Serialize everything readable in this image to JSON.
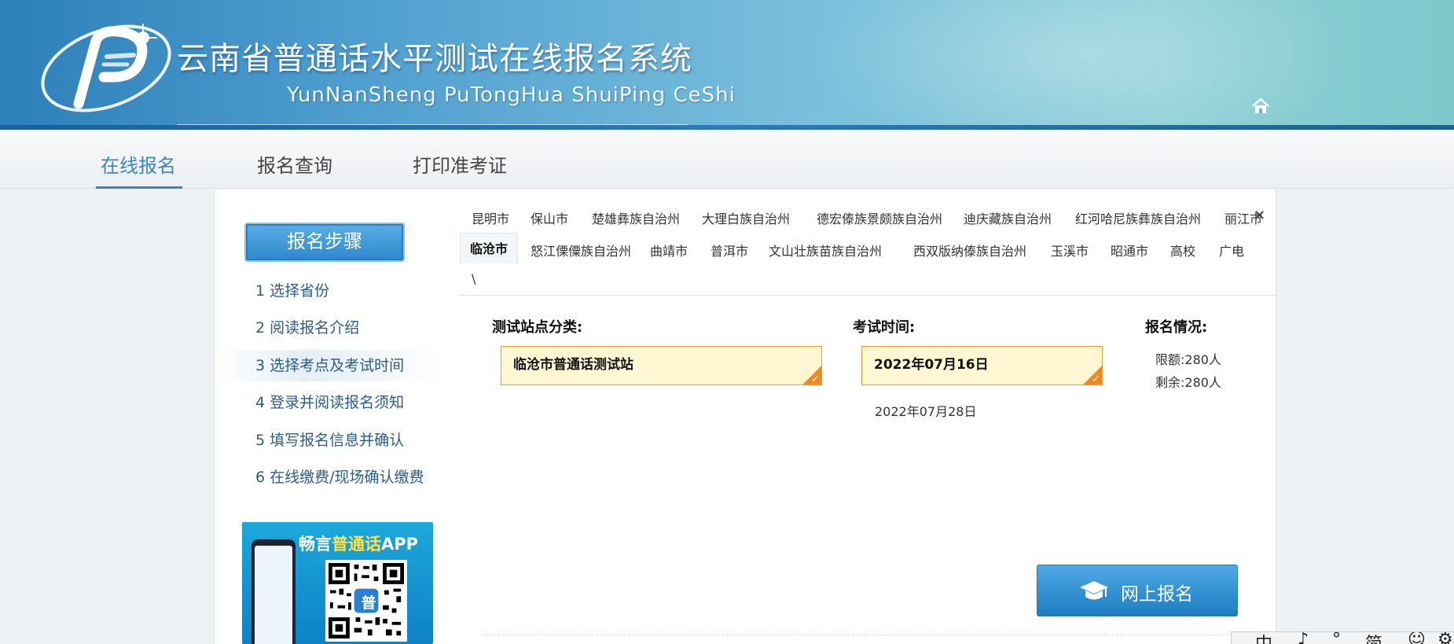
{
  "header": {
    "title": "云南省普通话水平测试在线报名系统",
    "subtitle": "YunNanSheng PuTongHua ShuiPing CeShi"
  },
  "topnav": {
    "items": [
      {
        "label": "在线报名",
        "active": true
      },
      {
        "label": "报名查询",
        "active": false
      },
      {
        "label": "打印准考证",
        "active": false
      }
    ]
  },
  "sidebar": {
    "title": "报名步骤",
    "steps": [
      {
        "label": "1 选择省份"
      },
      {
        "label": "2 阅读报名介绍"
      },
      {
        "label": "3 选择考点及考试时间",
        "active": true
      },
      {
        "label": "4 登录并阅读报名须知"
      },
      {
        "label": "5 填写报名信息并确认"
      },
      {
        "label": "6 在线缴费/现场确认缴费"
      }
    ],
    "ad": {
      "prefix": "畅言",
      "highlight": "普通话",
      "suffix": "APP",
      "qr_center": "普"
    }
  },
  "cities": {
    "row1": [
      "昆明市",
      "保山市",
      "楚雄彝族自治州",
      "大理白族自治州",
      "德宏傣族景颇族自治州",
      "迪庆藏族自治州",
      "红河哈尼族彝族自治州",
      "丽江市"
    ],
    "row2": [
      "临沧市",
      "怒江傈僳族自治州",
      "曲靖市",
      "普洱市",
      "文山壮族苗族自治州",
      "西双版纳傣族自治州",
      "玉溪市",
      "昭通市",
      "高校",
      "广电"
    ],
    "row3": [
      "\\"
    ],
    "active": "临沧市",
    "close_icon": "×"
  },
  "form": {
    "station_label": "测试站点分类:",
    "station_selected": "临沧市普通话测试站",
    "time_label": "考试时间:",
    "time_selected": "2022年07月16日",
    "time_other": "2022年07月28日",
    "status_label": "报名情况:",
    "quota": "限额:280人",
    "remaining": "剩余:280人",
    "register_button": "网上报名"
  },
  "ime": {
    "items": [
      "中",
      "♪",
      "°",
      "简",
      "☺",
      "⚙"
    ]
  },
  "colors": {
    "accent": "#3a86c8",
    "selected_bg": "#fff7d2",
    "selected_border": "#ee9a3a",
    "button": "#2485c9"
  }
}
